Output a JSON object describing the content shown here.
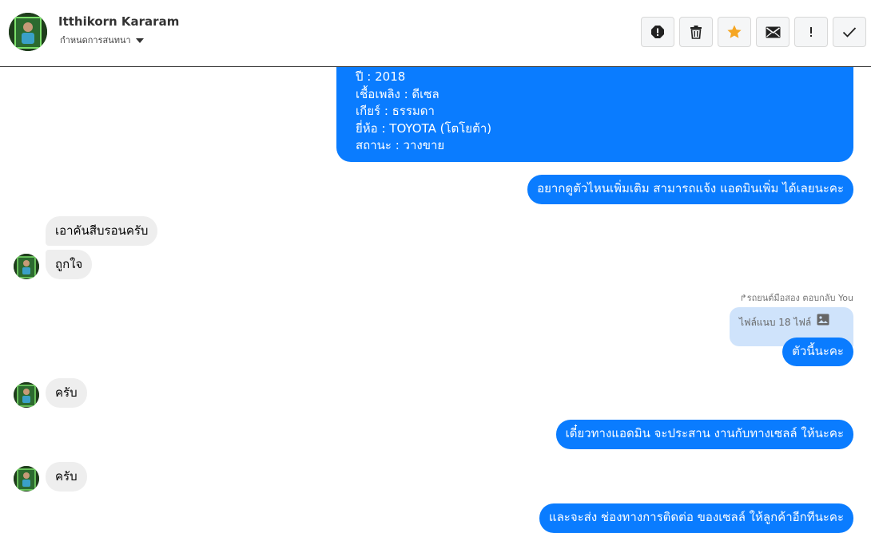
{
  "header": {
    "contact_name": "Itthikorn Kararam",
    "subtitle": "กำหนดการสนทนา"
  },
  "toolbar": [
    {
      "name": "report-icon"
    },
    {
      "name": "trash-icon"
    },
    {
      "name": "star-icon",
      "color": "#f5a623"
    },
    {
      "name": "mail-icon"
    },
    {
      "name": "exclamation-icon"
    },
    {
      "name": "check-icon"
    }
  ],
  "card": {
    "lines": [
      "ปี : 2018",
      "เชื้อเพลิง : ดีเซล",
      "เกียร์ : ธรรมดา",
      "ยี่ห้อ : TOYOTA (โตโยต้า)",
      "สถานะ : วางขาย"
    ]
  },
  "messages": {
    "m1": "อยากดูตัวไหนเพิ่มเติม สามารถแจ้ง แอดมินเพิ่ม ได้เลยนะคะ",
    "m2": "เอาคันสีบรอนครับ",
    "m3": "ถูกใจ",
    "reply_meta": "รถยนต์มือสอง ตอบกลับ You",
    "reply_attachment": "ไฟล์แนบ 18 ไฟล์",
    "m4": "ตัวนี้นะคะ",
    "m5": "ครับ",
    "m6": "เดี๋ยวทางแอดมิน จะประสาน งานกับทางเซลล์ ให้นะคะ",
    "m7": "ครับ",
    "m8": "และจะส่ง ช่องทางการติดต่อ ของเซลล์ ให้ลูกค้าอีกทีนะคะ"
  },
  "colors": {
    "outgoing": "#0a7cff",
    "incoming": "#eeeeee",
    "reply_bg": "#cfe3fb"
  }
}
